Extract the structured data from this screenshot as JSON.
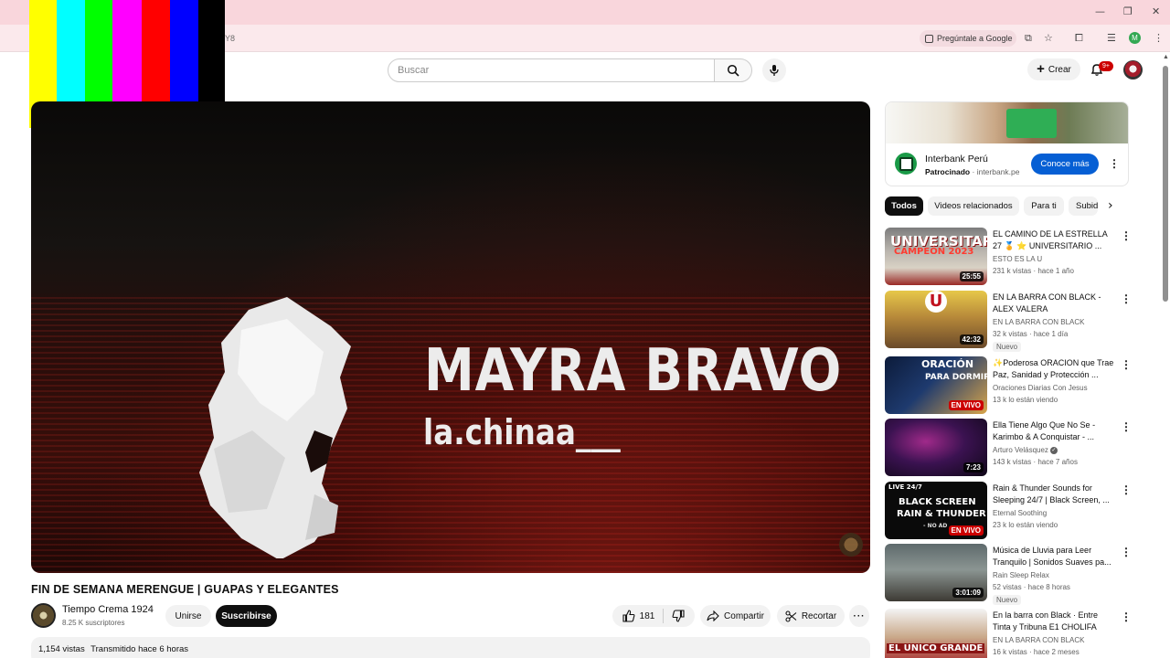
{
  "browser": {
    "url_fragment": "Y8",
    "gemini_label": "Pregúntale a Google",
    "profile_letter": "M"
  },
  "colors": {
    "tab_bar": "#f9d6dc",
    "subscribe_bg": "#0f0f0f",
    "ad_button": "#065fd4",
    "live_badge": "#cc0000",
    "color_bars": [
      "#ffff00",
      "#00ffff",
      "#00ff00",
      "#ff00ff",
      "#ff0000",
      "#0000ff",
      "#000000"
    ]
  },
  "header": {
    "search_placeholder": "Buscar",
    "create_label": "Crear",
    "notifications": "9+"
  },
  "video": {
    "overlay_name": "MAYRA BRAVO",
    "overlay_handle": "la.chinaa___",
    "title": "FIN DE SEMANA MERENGUE | GUAPAS Y ELEGANTES",
    "channel": "Tiempo Crema 1924",
    "subscribers": "8.25 K suscriptores",
    "join_label": "Unirse",
    "subscribe_label": "Suscribirse",
    "likes": "181",
    "share_label": "Compartir",
    "clip_label": "Recortar",
    "more_label": "···",
    "views": "1,154 vistas",
    "streamed": "Transmitido hace 6 horas"
  },
  "ad": {
    "advertiser": "Interbank Perú",
    "sponsored": "Patrocinado",
    "domain": "interbank.pe",
    "cta": "Conoce más"
  },
  "chips": [
    {
      "label": "Todos"
    },
    {
      "label": "Videos relacionados"
    },
    {
      "label": "Para ti"
    },
    {
      "label": "Subido"
    }
  ],
  "recommendations": [
    {
      "title": "EL CAMINO DE LA ESTRELLA 27 🏅 ⭐ UNIVERSITARIO ...",
      "channel": "ESTO ES LA U",
      "meta": "231 k vistas · hace 1 año",
      "duration": "25:55",
      "thumb_text": "UNIVERSITARIO",
      "thumb_text2": "CAMPEÓN 2023",
      "new": "",
      "live": ""
    },
    {
      "title": "EN LA BARRA CON BLACK - ALEX VALERA",
      "channel": "EN LA BARRA CON BLACK",
      "meta": "32 k vistas · hace 1 día",
      "duration": "42:32",
      "thumb_text": "U",
      "thumb_text2": "",
      "new": "Nuevo",
      "live": ""
    },
    {
      "title": "✨Poderosa ORACION que Trae Paz, Sanidad y Protección ...",
      "channel": "Oraciones Diarias Con Jesus",
      "meta": "13 k lo están viendo",
      "duration": "",
      "thumb_text": "ORACIÓN",
      "thumb_text2": "PARA DORMIR",
      "new": "",
      "live": "EN VIVO"
    },
    {
      "title": "Ella Tiene Algo Que No Se - Karimbo & A Conquistar - ...",
      "channel": "Arturo Velásquez",
      "meta": "143 k vistas · hace 7 años",
      "duration": "7:23",
      "thumb_text": "",
      "thumb_text2": "",
      "new": "",
      "live": ""
    },
    {
      "title": "Rain & Thunder Sounds for Sleeping 24/7 | Black Screen, ...",
      "channel": "Eternal Soothing",
      "meta": "23 k lo están viendo",
      "duration": "",
      "thumb_text": "BLACK SCREEN",
      "thumb_text2": "RAIN & THUNDER",
      "new": "",
      "live": "EN VIVO",
      "thumb_tag": "LIVE 24/7",
      "thumb_note": "- NO AD"
    },
    {
      "title": "Música de Lluvia para Leer Tranquilo | Sonidos Suaves pa...",
      "channel": "Rain Sleep Relax",
      "meta": "52 vistas · hace 8 horas",
      "duration": "3:01:09",
      "thumb_text": "",
      "thumb_text2": "",
      "new": "Nuevo",
      "live": ""
    },
    {
      "title": "En la barra con Black · Entre Tinta y Tribuna E1 CHOLIFA",
      "channel": "EN LA BARRA CON BLACK",
      "meta": "16 k vistas · hace 2 meses",
      "duration": "",
      "thumb_text": "EL UNICO GRANDE",
      "thumb_text2": "",
      "new": "",
      "live": ""
    }
  ]
}
